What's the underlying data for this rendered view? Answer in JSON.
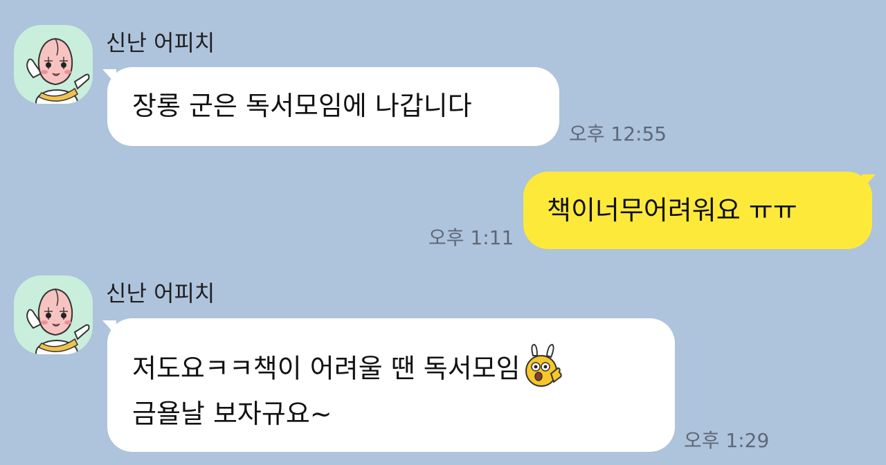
{
  "chat": {
    "messages": [
      {
        "sender": "신난 어피치",
        "text": "장롱 군은 독서모임에 나갑니다",
        "time": "오후 12:55"
      },
      {
        "sender": "me",
        "text": "책이너무어려워요 ㅠㅠ",
        "time": "오후 1:11"
      },
      {
        "sender": "신난 어피치",
        "lines": [
          "저도요ㅋㅋ책이 어려울 땐 독서모임",
          "금욜날 보자규요~"
        ],
        "time": "오후 1:29",
        "emoticon": "thumbs-up-character-icon"
      }
    ]
  },
  "colors": {
    "background": "#aec3dc",
    "incoming_bubble": "#ffffff",
    "outgoing_bubble": "#fde93a",
    "avatar_background": "#c9eedb"
  },
  "icons": {
    "avatar": "peach-character-avatar-icon"
  }
}
